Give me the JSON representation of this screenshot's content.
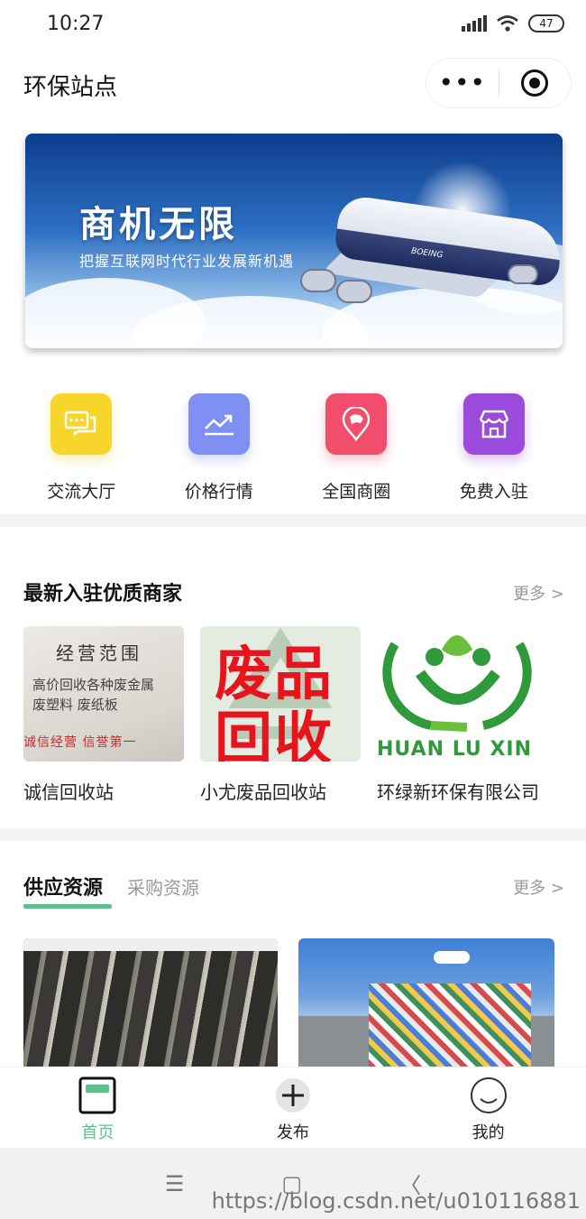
{
  "status_bar": {
    "time": "10:27",
    "battery": "47"
  },
  "nav": {
    "title": "环保站点",
    "more_icon": "more-dots-icon",
    "close_icon": "target-icon"
  },
  "banner": {
    "title": "商机无限",
    "subtitle": "把握互联网时代行业发展新机遇",
    "plane_brand": "BOEING"
  },
  "quick_icons": [
    {
      "label": "交流大厅",
      "icon": "chat-icon",
      "color": "#f7d52a"
    },
    {
      "label": "价格行情",
      "icon": "trend-chart-icon",
      "color": "#7f8ff2"
    },
    {
      "label": "全国商圈",
      "icon": "map-pin-icon",
      "color": "#f04e6c"
    },
    {
      "label": "免费入驻",
      "icon": "store-icon",
      "color": "#9a4bdc"
    }
  ],
  "merchants": {
    "title": "最新入驻优质商家",
    "more": "更多 >",
    "items": [
      {
        "name": "诚信回收站",
        "img_heading": "经营范围",
        "img_line1": "高价回收各种废金属",
        "img_line2": "废塑料 废纸板",
        "img_footer": "诚信经营 信誉第一"
      },
      {
        "name": "小尤废品回收站",
        "img_line1": "废品",
        "img_line2": "回收"
      },
      {
        "name": "环绿新环保有限公司",
        "img_text": "HUAN LU XIN"
      }
    ]
  },
  "supply": {
    "active_tab": "供应资源",
    "inactive_tab": "采购资源",
    "more": "更多 >"
  },
  "tabbar": {
    "items": [
      {
        "label": "首页",
        "icon": "home-icon",
        "active": true
      },
      {
        "label": "发布",
        "icon": "plus-icon",
        "active": false
      },
      {
        "label": "我的",
        "icon": "smile-icon",
        "active": false
      }
    ],
    "active_color": "#5ec08f"
  },
  "system_nav": {
    "menu": "☰",
    "home": "▢",
    "back": "〈"
  },
  "watermark": "https://blog.csdn.net/u010116881"
}
